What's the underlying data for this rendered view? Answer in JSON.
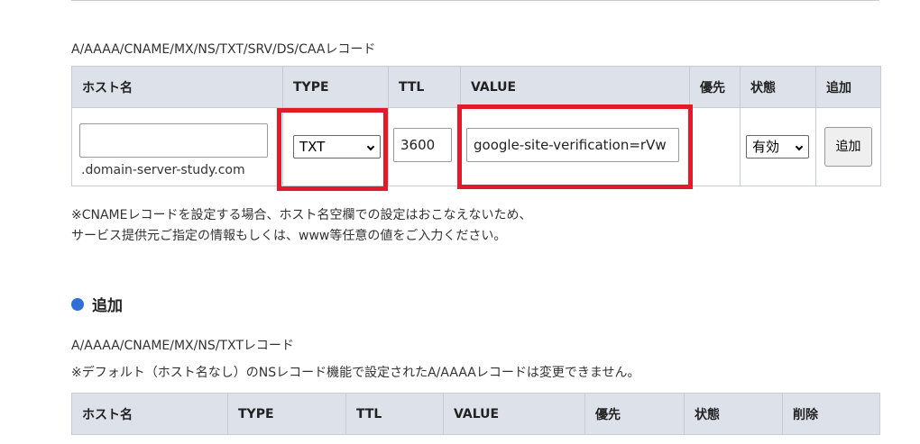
{
  "record_types_caption": "A/AAAA/CNAME/MX/NS/TXT/SRV/DS/CAAレコード",
  "add_table": {
    "headers": {
      "host": "ホスト名",
      "type": "TYPE",
      "ttl": "TTL",
      "value": "VALUE",
      "priority": "優先",
      "status": "状態",
      "add": "追加"
    },
    "row": {
      "host_value": "",
      "domain_suffix": ".domain-server-study.com",
      "type_selected": "TXT",
      "ttl_value": "3600",
      "value_text": "google-site-verification=rVw",
      "status_selected": "有効",
      "add_button": "追加"
    }
  },
  "notes": {
    "line1": "※CNAMEレコードを設定する場合、ホスト名空欄での設定はおこなえないため、",
    "line2": "サービス提供元ご指定の情報もしくは、www等任意の値をご入力ください。"
  },
  "section_added": {
    "title": "追加",
    "caption": "A/AAAA/CNAME/MX/NS/TXTレコード",
    "note": "※デフォルト（ホスト名なし）のNSレコード機能で設定されたA/AAAAレコードは変更できません。",
    "headers": {
      "host": "ホスト名",
      "type": "TYPE",
      "ttl": "TTL",
      "value": "VALUE",
      "priority": "優先",
      "status": "状態",
      "delete": "削除"
    }
  },
  "colors": {
    "highlight": "#e11c2a",
    "header_bg": "#dde2ea",
    "bullet": "#2f6fd6"
  }
}
